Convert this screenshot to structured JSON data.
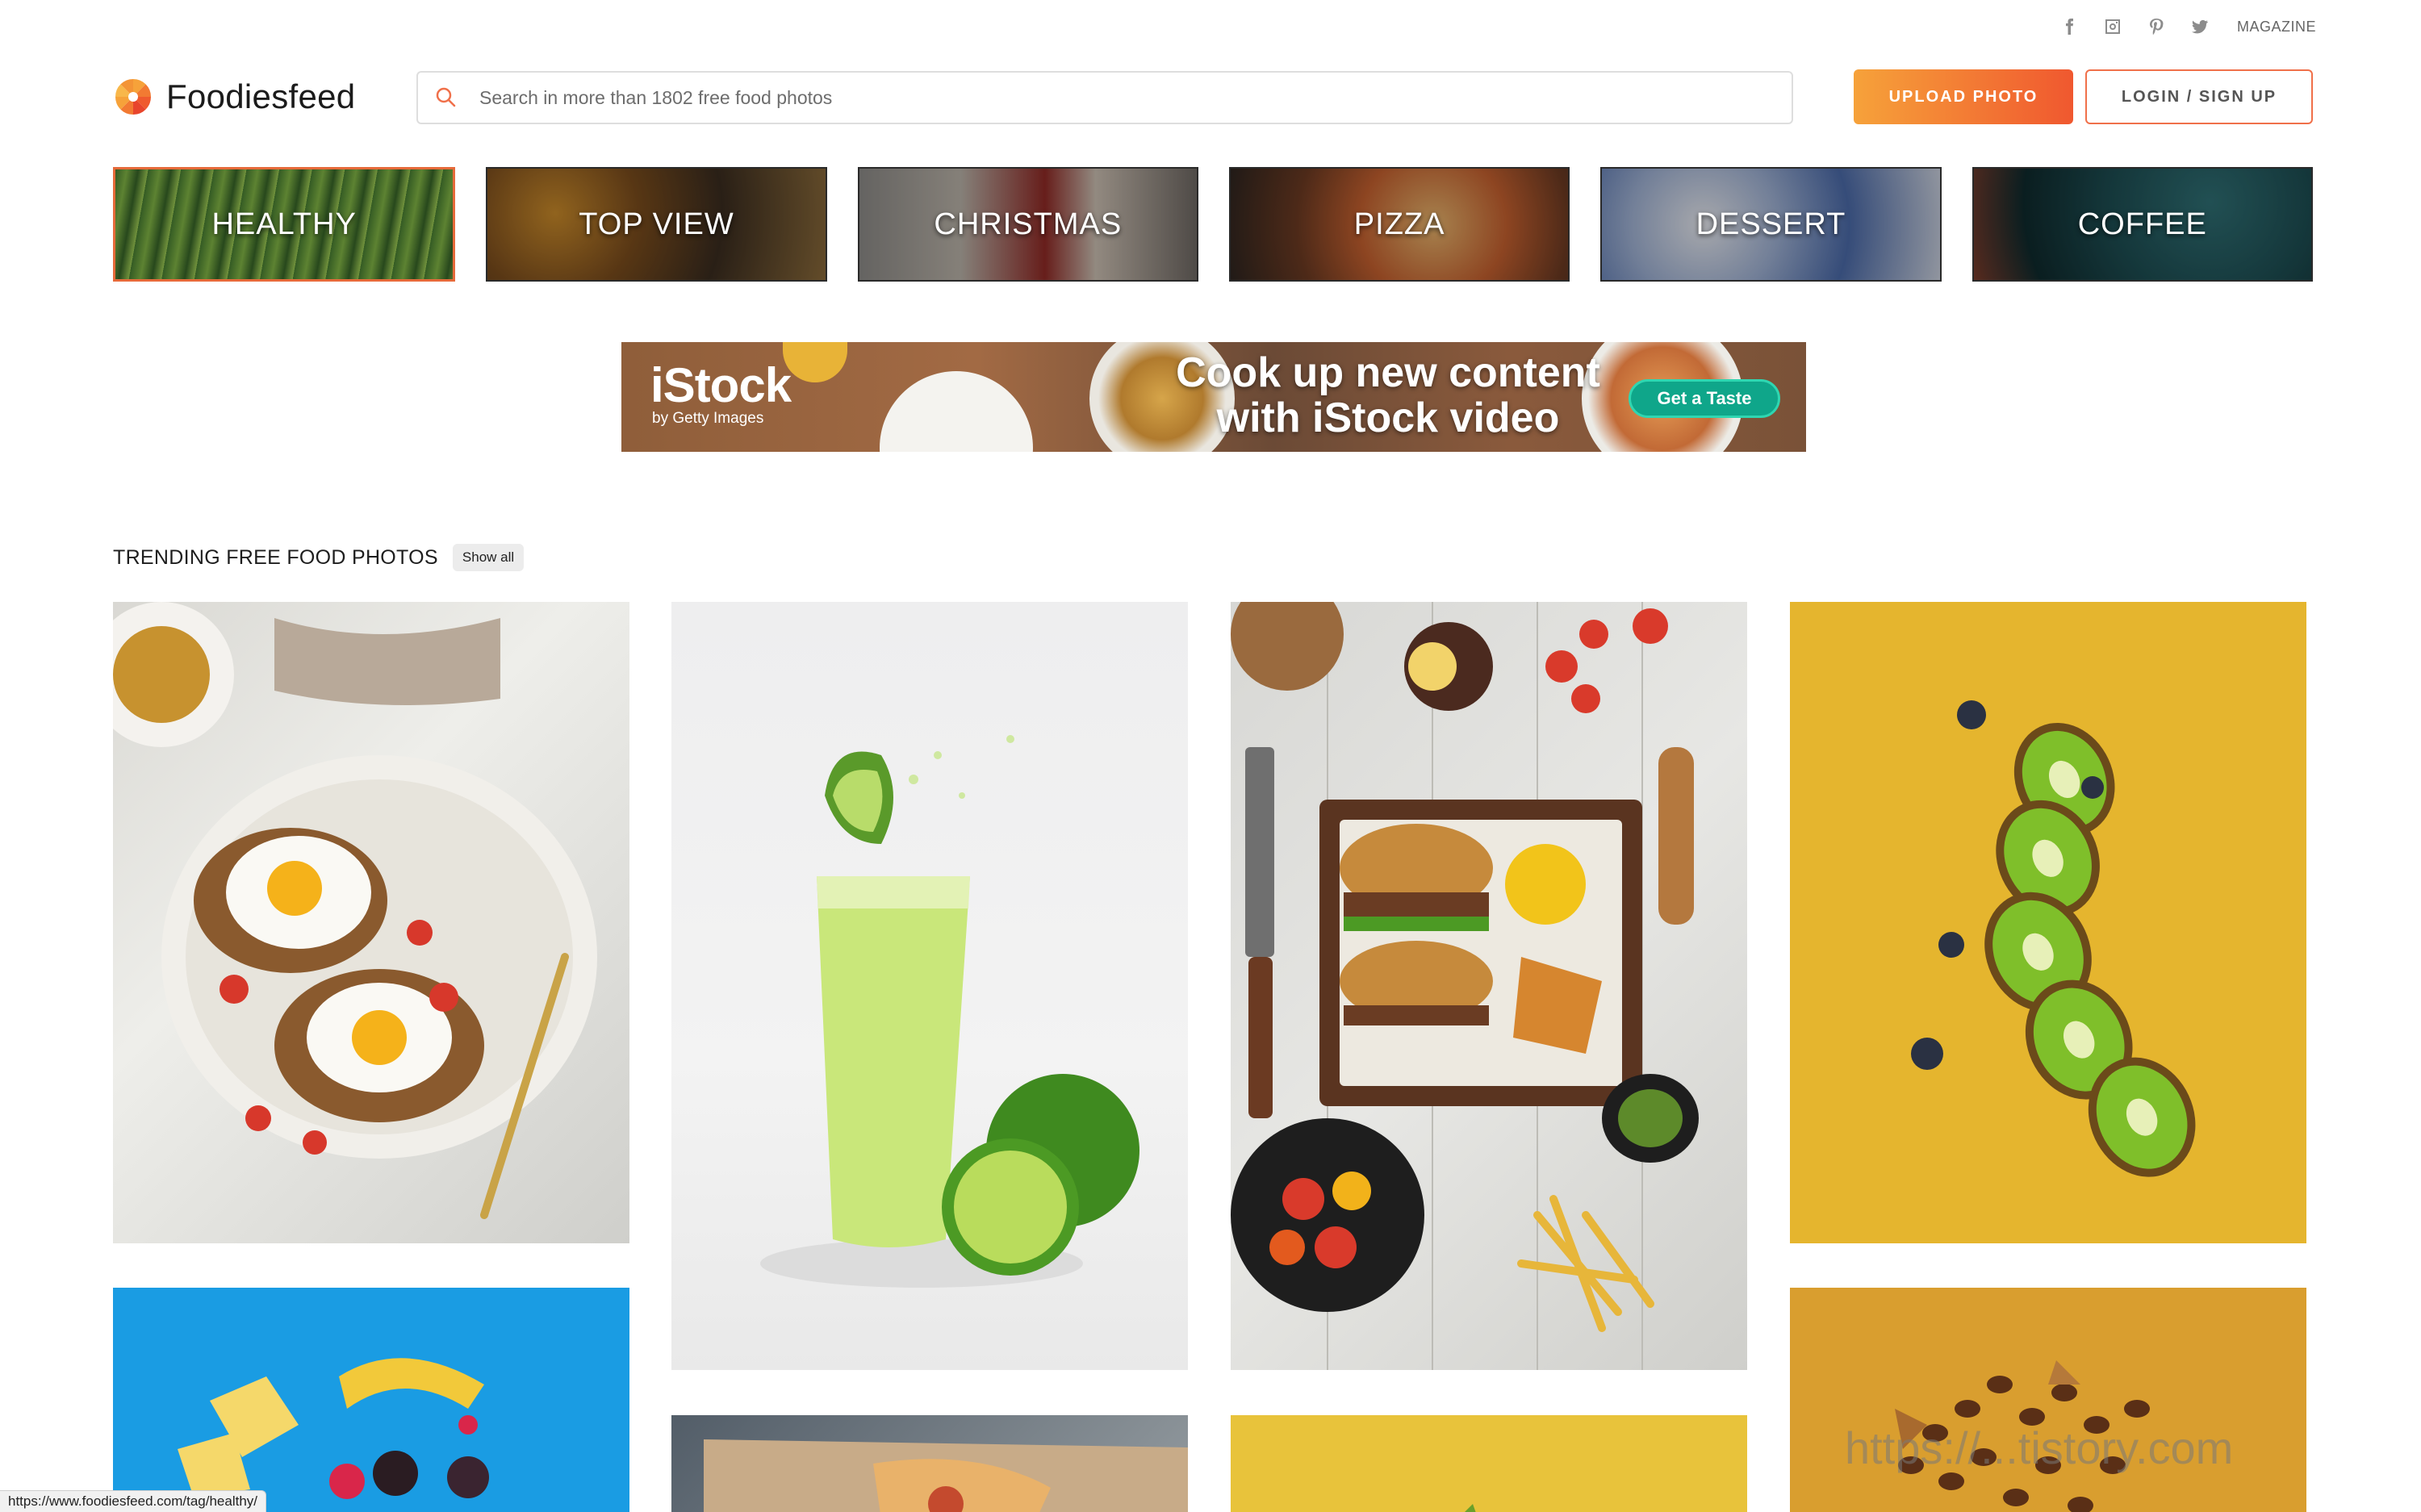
{
  "topbar": {
    "social": [
      {
        "name": "facebook-icon"
      },
      {
        "name": "instagram-icon"
      },
      {
        "name": "pinterest-icon"
      },
      {
        "name": "twitter-icon"
      }
    ],
    "magazine_label": "MAGAZINE"
  },
  "header": {
    "logo_text": "Foodiesfeed",
    "search_placeholder": "Search in more than 1802 free food photos",
    "upload_label": "UPLOAD PHOTO",
    "login_label": "LOGIN / SIGN UP"
  },
  "categories": [
    {
      "label": "HEALTHY",
      "active": true
    },
    {
      "label": "TOP VIEW"
    },
    {
      "label": "CHRISTMAS"
    },
    {
      "label": "PIZZA"
    },
    {
      "label": "DESSERT"
    },
    {
      "label": "COFFEE"
    }
  ],
  "ad": {
    "brand": "iStock",
    "brand_sub": "by Getty Images",
    "headline_line1": "Cook up new content",
    "headline_line2": "with iStock video",
    "cta": "Get a Taste"
  },
  "trending": {
    "title": "TRENDING FREE FOOD PHOTOS",
    "show_all": "Show all"
  },
  "status_url": "https://www.foodiesfeed.com/tag/healthy/",
  "watermark": "https://...tistory.com",
  "colors": {
    "accent_orange": "#f0582f",
    "accent_gradient_start": "#f6a23a",
    "ad_cta": "#0fa68a"
  }
}
